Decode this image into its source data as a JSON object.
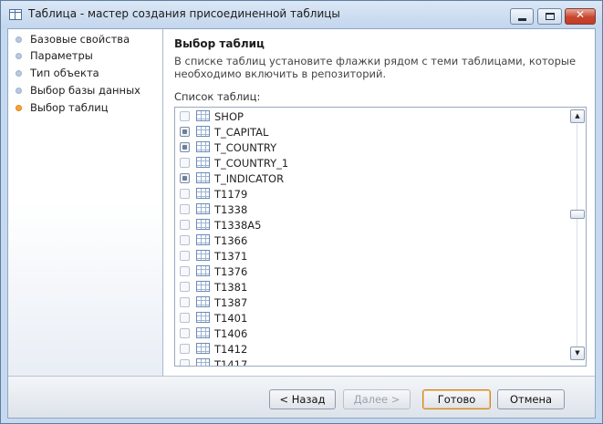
{
  "window": {
    "title": "Таблица - мастер создания присоединенной таблицы",
    "controls": {
      "minimize": "—",
      "maximize": "□",
      "close": "✕"
    }
  },
  "sidebar": {
    "steps": [
      {
        "label": "Базовые свойства",
        "active": false
      },
      {
        "label": "Параметры",
        "active": false
      },
      {
        "label": "Тип объекта",
        "active": false
      },
      {
        "label": "Выбор базы данных",
        "active": false
      },
      {
        "label": "Выбор таблиц",
        "active": true
      }
    ]
  },
  "main": {
    "heading": "Выбор таблиц",
    "description": "В списке таблиц установите флажки рядом с теми таблицами, которые необходимо включить в  репозиторий.",
    "list_caption": "Список таблиц:",
    "tables": [
      {
        "name": "SHOP",
        "checked": false
      },
      {
        "name": "T_CAPITAL",
        "checked": true
      },
      {
        "name": "T_COUNTRY",
        "checked": true
      },
      {
        "name": "T_COUNTRY_1",
        "checked": false
      },
      {
        "name": "T_INDICATOR",
        "checked": true
      },
      {
        "name": "T1179",
        "checked": false
      },
      {
        "name": "T1338",
        "checked": false
      },
      {
        "name": "T1338A5",
        "checked": false
      },
      {
        "name": "T1366",
        "checked": false
      },
      {
        "name": "T1371",
        "checked": false
      },
      {
        "name": "T1376",
        "checked": false
      },
      {
        "name": "T1381",
        "checked": false
      },
      {
        "name": "T1387",
        "checked": false
      },
      {
        "name": "T1401",
        "checked": false
      },
      {
        "name": "T1406",
        "checked": false
      },
      {
        "name": "T1412",
        "checked": false
      },
      {
        "name": "T1417",
        "checked": false
      }
    ],
    "scrollbar": {
      "up": "▲",
      "down": "▼"
    }
  },
  "footer": {
    "back_label": "< Назад",
    "next_label": "Далее >",
    "finish_label": "Готово",
    "cancel_label": "Отмена"
  },
  "colors": {
    "active_step_dot": "#f6a43a",
    "inactive_step_dot": "#b9c9df",
    "window_frame": "#c6d9ee",
    "close_button": "#c8452f"
  }
}
